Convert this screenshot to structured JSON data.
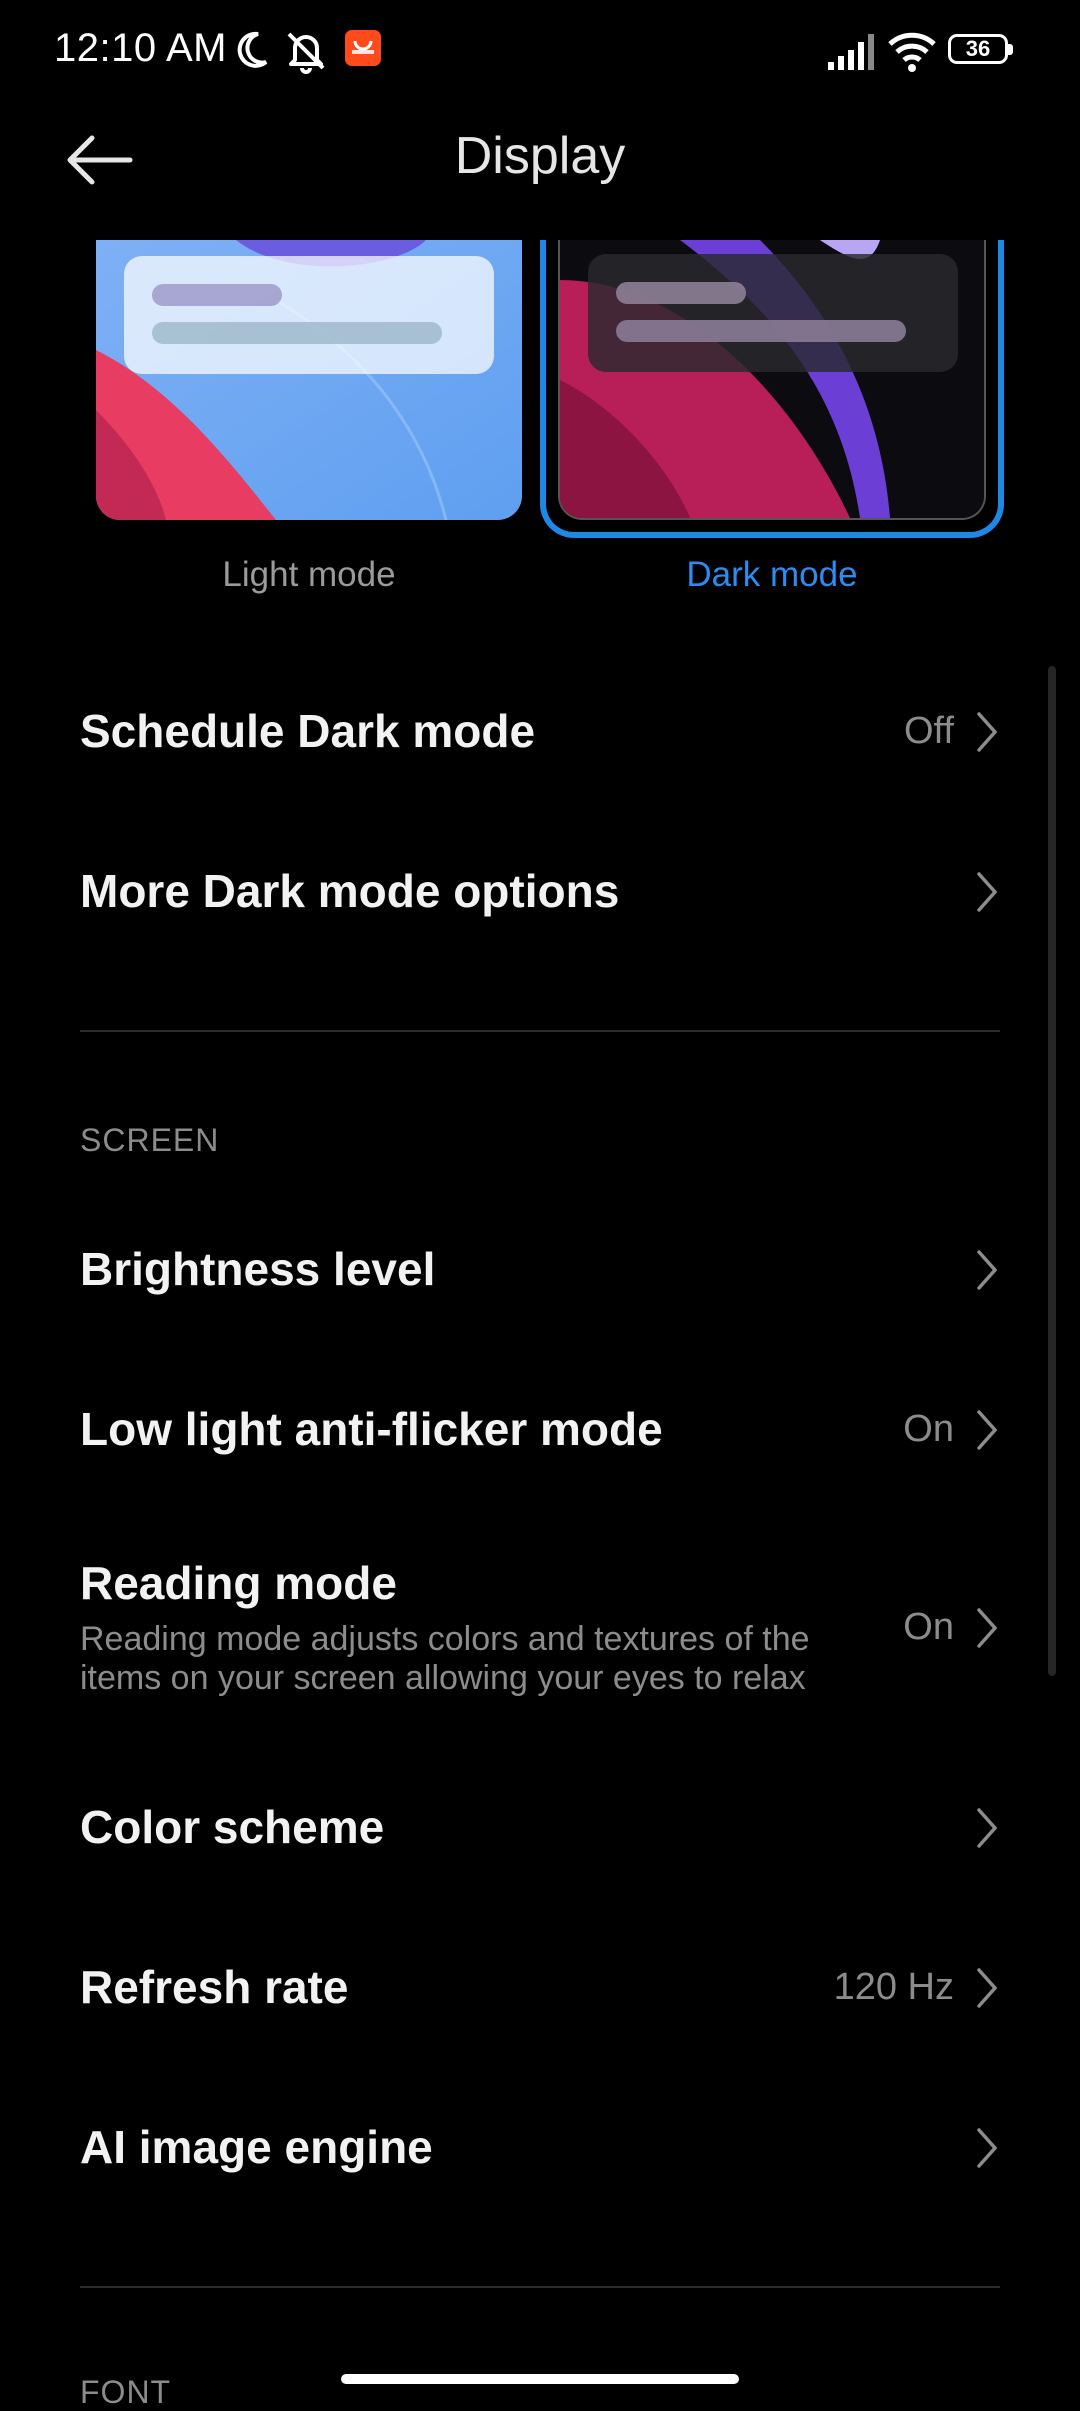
{
  "status_bar": {
    "time": "12:10 AM",
    "battery": "36"
  },
  "header": {
    "title": "Display"
  },
  "theme": {
    "light_label": "Light mode",
    "dark_label": "Dark mode",
    "selected": "Dark mode",
    "accent_color": "#1e88e5"
  },
  "rows": {
    "schedule": {
      "title": "Schedule Dark mode",
      "value": "Off"
    },
    "more_dark": {
      "title": "More Dark mode options"
    }
  },
  "screen_section": {
    "header": "SCREEN",
    "brightness": {
      "title": "Brightness level"
    },
    "anti_flicker": {
      "title": "Low light anti-flicker mode",
      "value": "On"
    },
    "reading": {
      "title": "Reading mode",
      "desc_line1": "Reading mode adjusts colors and textures of the",
      "desc_line2": "items on your screen allowing your eyes to relax",
      "value": "On"
    },
    "color_scheme": {
      "title": "Color scheme"
    },
    "refresh_rate": {
      "title": "Refresh rate",
      "value": "120 Hz"
    },
    "ai_engine": {
      "title": "AI image engine"
    }
  },
  "font_section": {
    "header": "FONT"
  }
}
